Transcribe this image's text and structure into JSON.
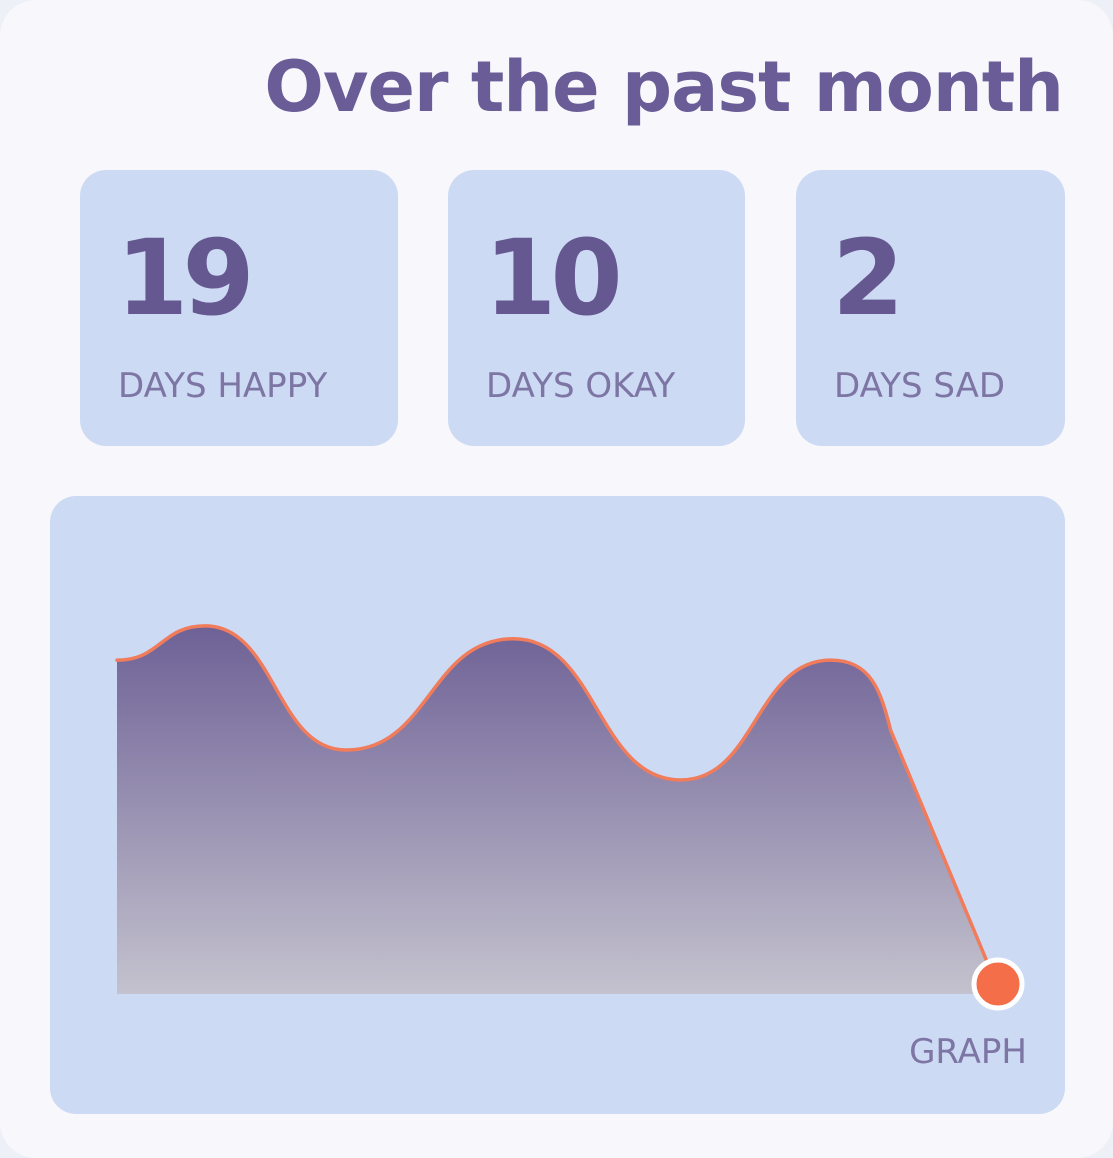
{
  "header": {
    "title": "Over the past month"
  },
  "stats": [
    {
      "value": "19",
      "label": "DAYS HAPPY"
    },
    {
      "value": "10",
      "label": "DAYS OKAY"
    },
    {
      "value": "2",
      "label": "DAYS SAD"
    }
  ],
  "graph": {
    "label": "GRAPH"
  },
  "colors": {
    "card_bg": "#f8f8fc",
    "panel_bg": "#cddaf4",
    "text_primary": "#65578f",
    "text_secondary": "#7d75a3",
    "area_top": "#6e6196",
    "area_bottom": "#c4c2ce",
    "line": "#f07c5c",
    "end_marker": "#f56e4a"
  },
  "chart_data": {
    "type": "area",
    "x": [
      1,
      2,
      3,
      4,
      5,
      6,
      7,
      8,
      9,
      10,
      11
    ],
    "values": [
      0.78,
      0.86,
      0.57,
      0.83,
      0.5,
      0.78,
      0.0
    ],
    "ylim": [
      0,
      1
    ],
    "grid": false,
    "end_marker": true
  }
}
